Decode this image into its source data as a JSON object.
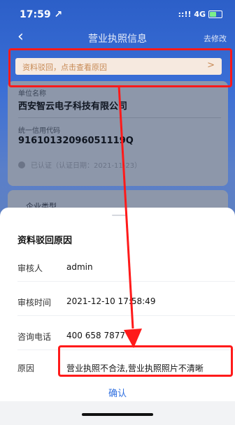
{
  "status_bar": {
    "time": "17:59",
    "location_glyph": "↗",
    "signal": "::!! 4G"
  },
  "nav": {
    "back_glyph": "‹",
    "title": "营业执照信息",
    "edit_label": "去修改"
  },
  "reject_notice": {
    "text": "资料驳回，点击查看原因",
    "chevron": ">"
  },
  "company": {
    "name_label": "单位名称",
    "name_value": "西安智云电子科技有限公司",
    "credit_label": "统一信用代码",
    "credit_value": "91610132096051119Q",
    "verified_text": "已认证（认证日期：2021-11-23）"
  },
  "card2": {
    "label": "企业类型"
  },
  "sheet": {
    "title": "资料驳回原因",
    "rows": [
      {
        "key": "审核人",
        "value": "admin"
      },
      {
        "key": "审核时间",
        "value": "2021-12-10 17:58:49"
      },
      {
        "key": "咨询电话",
        "value": "400 658 7877"
      },
      {
        "key": "原因",
        "value": "营业执照不合法,营业执照照片不清晰"
      }
    ],
    "confirm_label": "确认"
  },
  "colors": {
    "highlight": "#ff1a1a",
    "accent": "#2f6fe0",
    "primary": "#2c5fc8"
  }
}
